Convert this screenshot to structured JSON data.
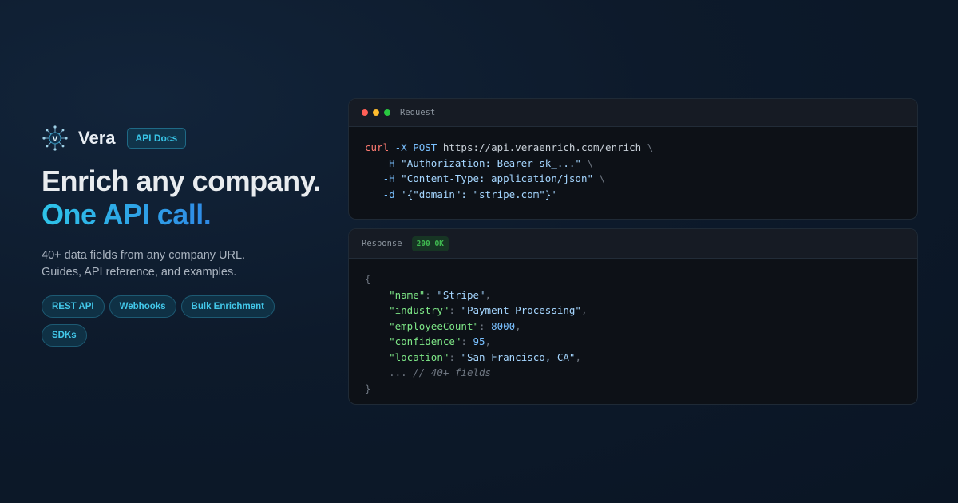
{
  "brand": {
    "name": "Vera",
    "logo_letter": "V",
    "badge": "API Docs"
  },
  "hero": {
    "title_part1": "Enrich any company.",
    "title_part2": "One API call.",
    "subtitle_line1": "40+ data fields from any company URL.",
    "subtitle_line2": "Guides, API reference, and examples."
  },
  "tags": [
    "REST API",
    "Webhooks",
    "Bulk Enrichment",
    "SDKs"
  ],
  "request": {
    "title": "Request",
    "cmd": "curl",
    "method_flag": "-X POST",
    "url": "https://api.veraenrich.com/enrich",
    "backslash": "\\",
    "h_flag": "-H",
    "auth_header": "\"Authorization: Bearer sk_...\"",
    "content_header": "\"Content-Type: application/json\"",
    "d_flag": "-d",
    "body": "'{\"domain\": \"stripe.com\"}'"
  },
  "response": {
    "title": "Response",
    "status": "200 OK",
    "open_brace": "{",
    "close_brace": "}",
    "fields": [
      {
        "key": "\"name\"",
        "value": "\"Stripe\"",
        "type": "string"
      },
      {
        "key": "\"industry\"",
        "value": "\"Payment Processing\"",
        "type": "string"
      },
      {
        "key": "\"employeeCount\"",
        "value": "8000",
        "type": "number"
      },
      {
        "key": "\"confidence\"",
        "value": "95",
        "type": "number"
      },
      {
        "key": "\"location\"",
        "value": "\"San Francisco, CA\"",
        "type": "string"
      }
    ],
    "ellipsis": "...",
    "comment": "// 40+ fields"
  },
  "colors": {
    "accent_start": "#2ec4e8",
    "accent_end": "#2f8ae6",
    "dot_red": "#ff5f57",
    "dot_yellow": "#febc2e",
    "dot_green": "#28c840"
  }
}
